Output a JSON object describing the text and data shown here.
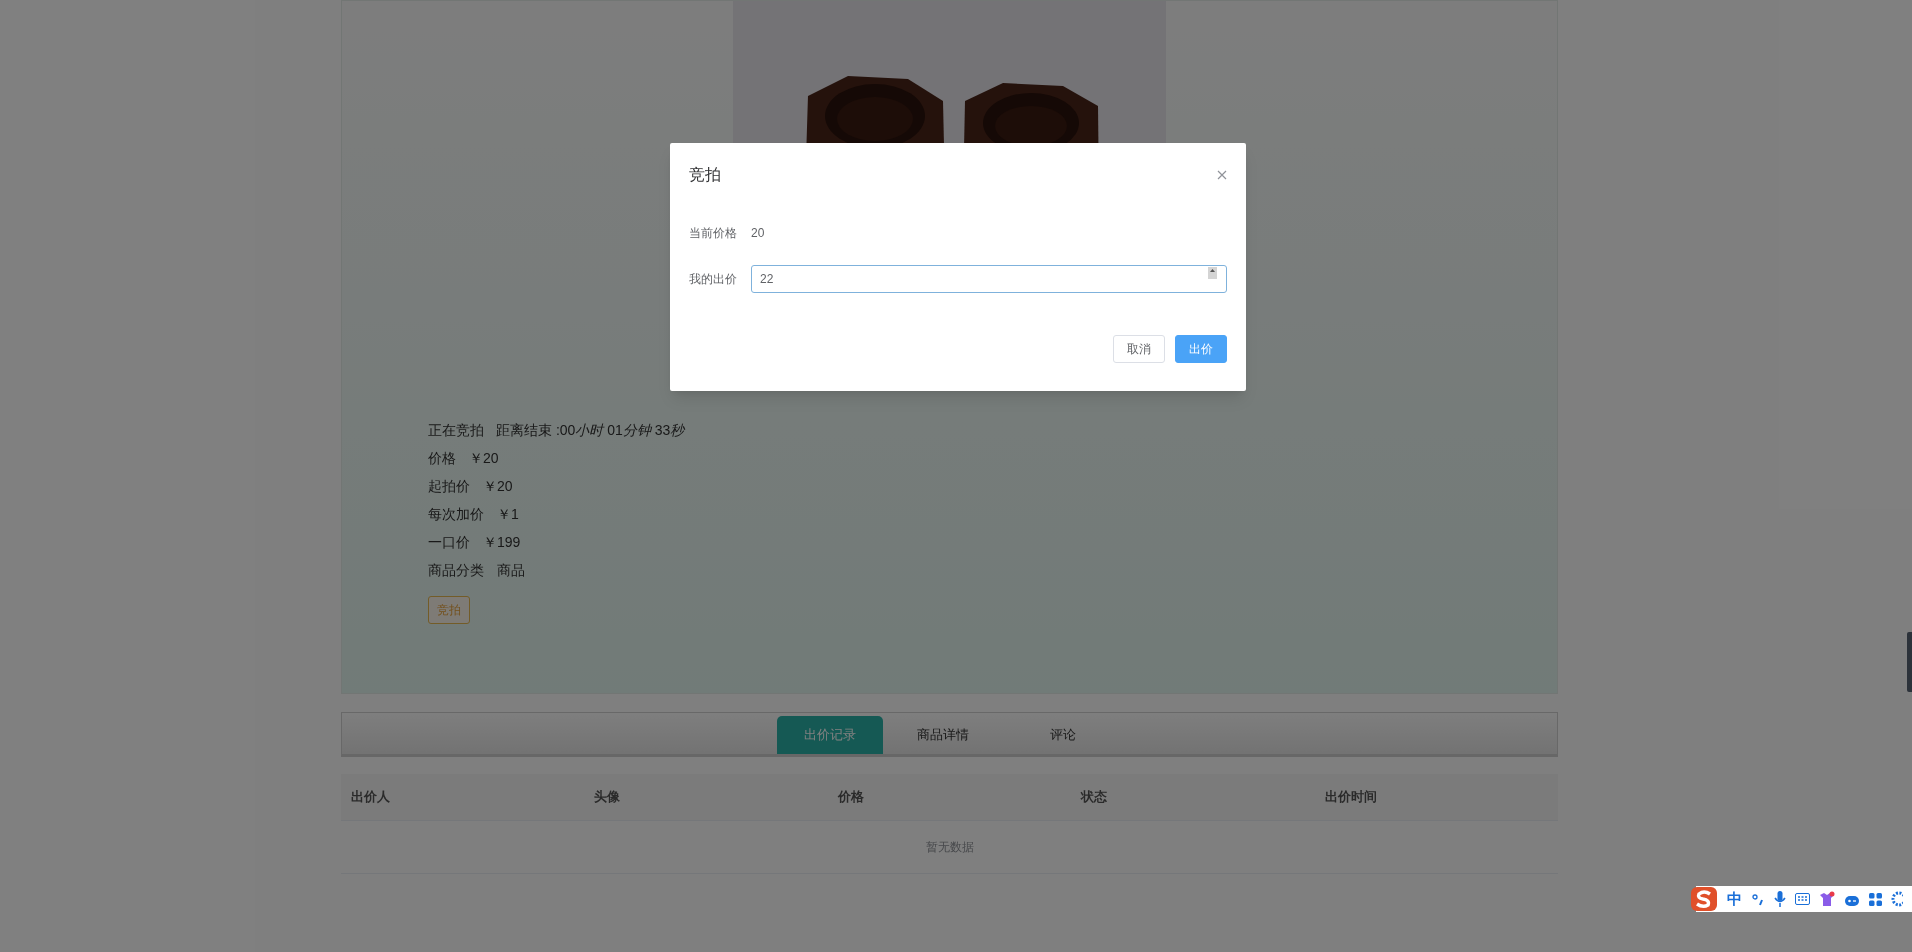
{
  "product": {
    "status": "正在竞拍",
    "countdown": [
      {
        "text": "距离结束 :00",
        "italic": false
      },
      {
        "text": "小时",
        "italic": true
      },
      {
        "text": " 01",
        "italic": false
      },
      {
        "text": "分钟",
        "italic": true
      },
      {
        "text": " 33",
        "italic": false
      },
      {
        "text": "秒",
        "italic": true
      }
    ],
    "details": [
      {
        "label": "价格",
        "value": "￥20"
      },
      {
        "label": "起拍价",
        "value": "￥20"
      },
      {
        "label": "每次加价",
        "value": "￥1"
      },
      {
        "label": "一口价",
        "value": "￥199"
      },
      {
        "label": "商品分类",
        "value": "商品"
      }
    ],
    "bid_button": "竞拍"
  },
  "tabs": [
    {
      "label": "出价记录",
      "selected": true
    },
    {
      "label": "商品详情",
      "selected": false
    },
    {
      "label": "评论",
      "selected": false
    }
  ],
  "table": {
    "columns": [
      "出价人",
      "头像",
      "价格",
      "状态",
      "出价时间"
    ],
    "empty_text": "暂无数据"
  },
  "dialog": {
    "title": "竞拍",
    "fields": [
      {
        "kind": "text",
        "label": "当前价格",
        "value": "20"
      },
      {
        "kind": "input",
        "label": "我的出价",
        "value": "22"
      }
    ],
    "buttons": [
      {
        "kind": "default",
        "label": "取消"
      },
      {
        "kind": "primary",
        "label": "出价"
      }
    ]
  },
  "ime": {
    "mode": "中"
  }
}
